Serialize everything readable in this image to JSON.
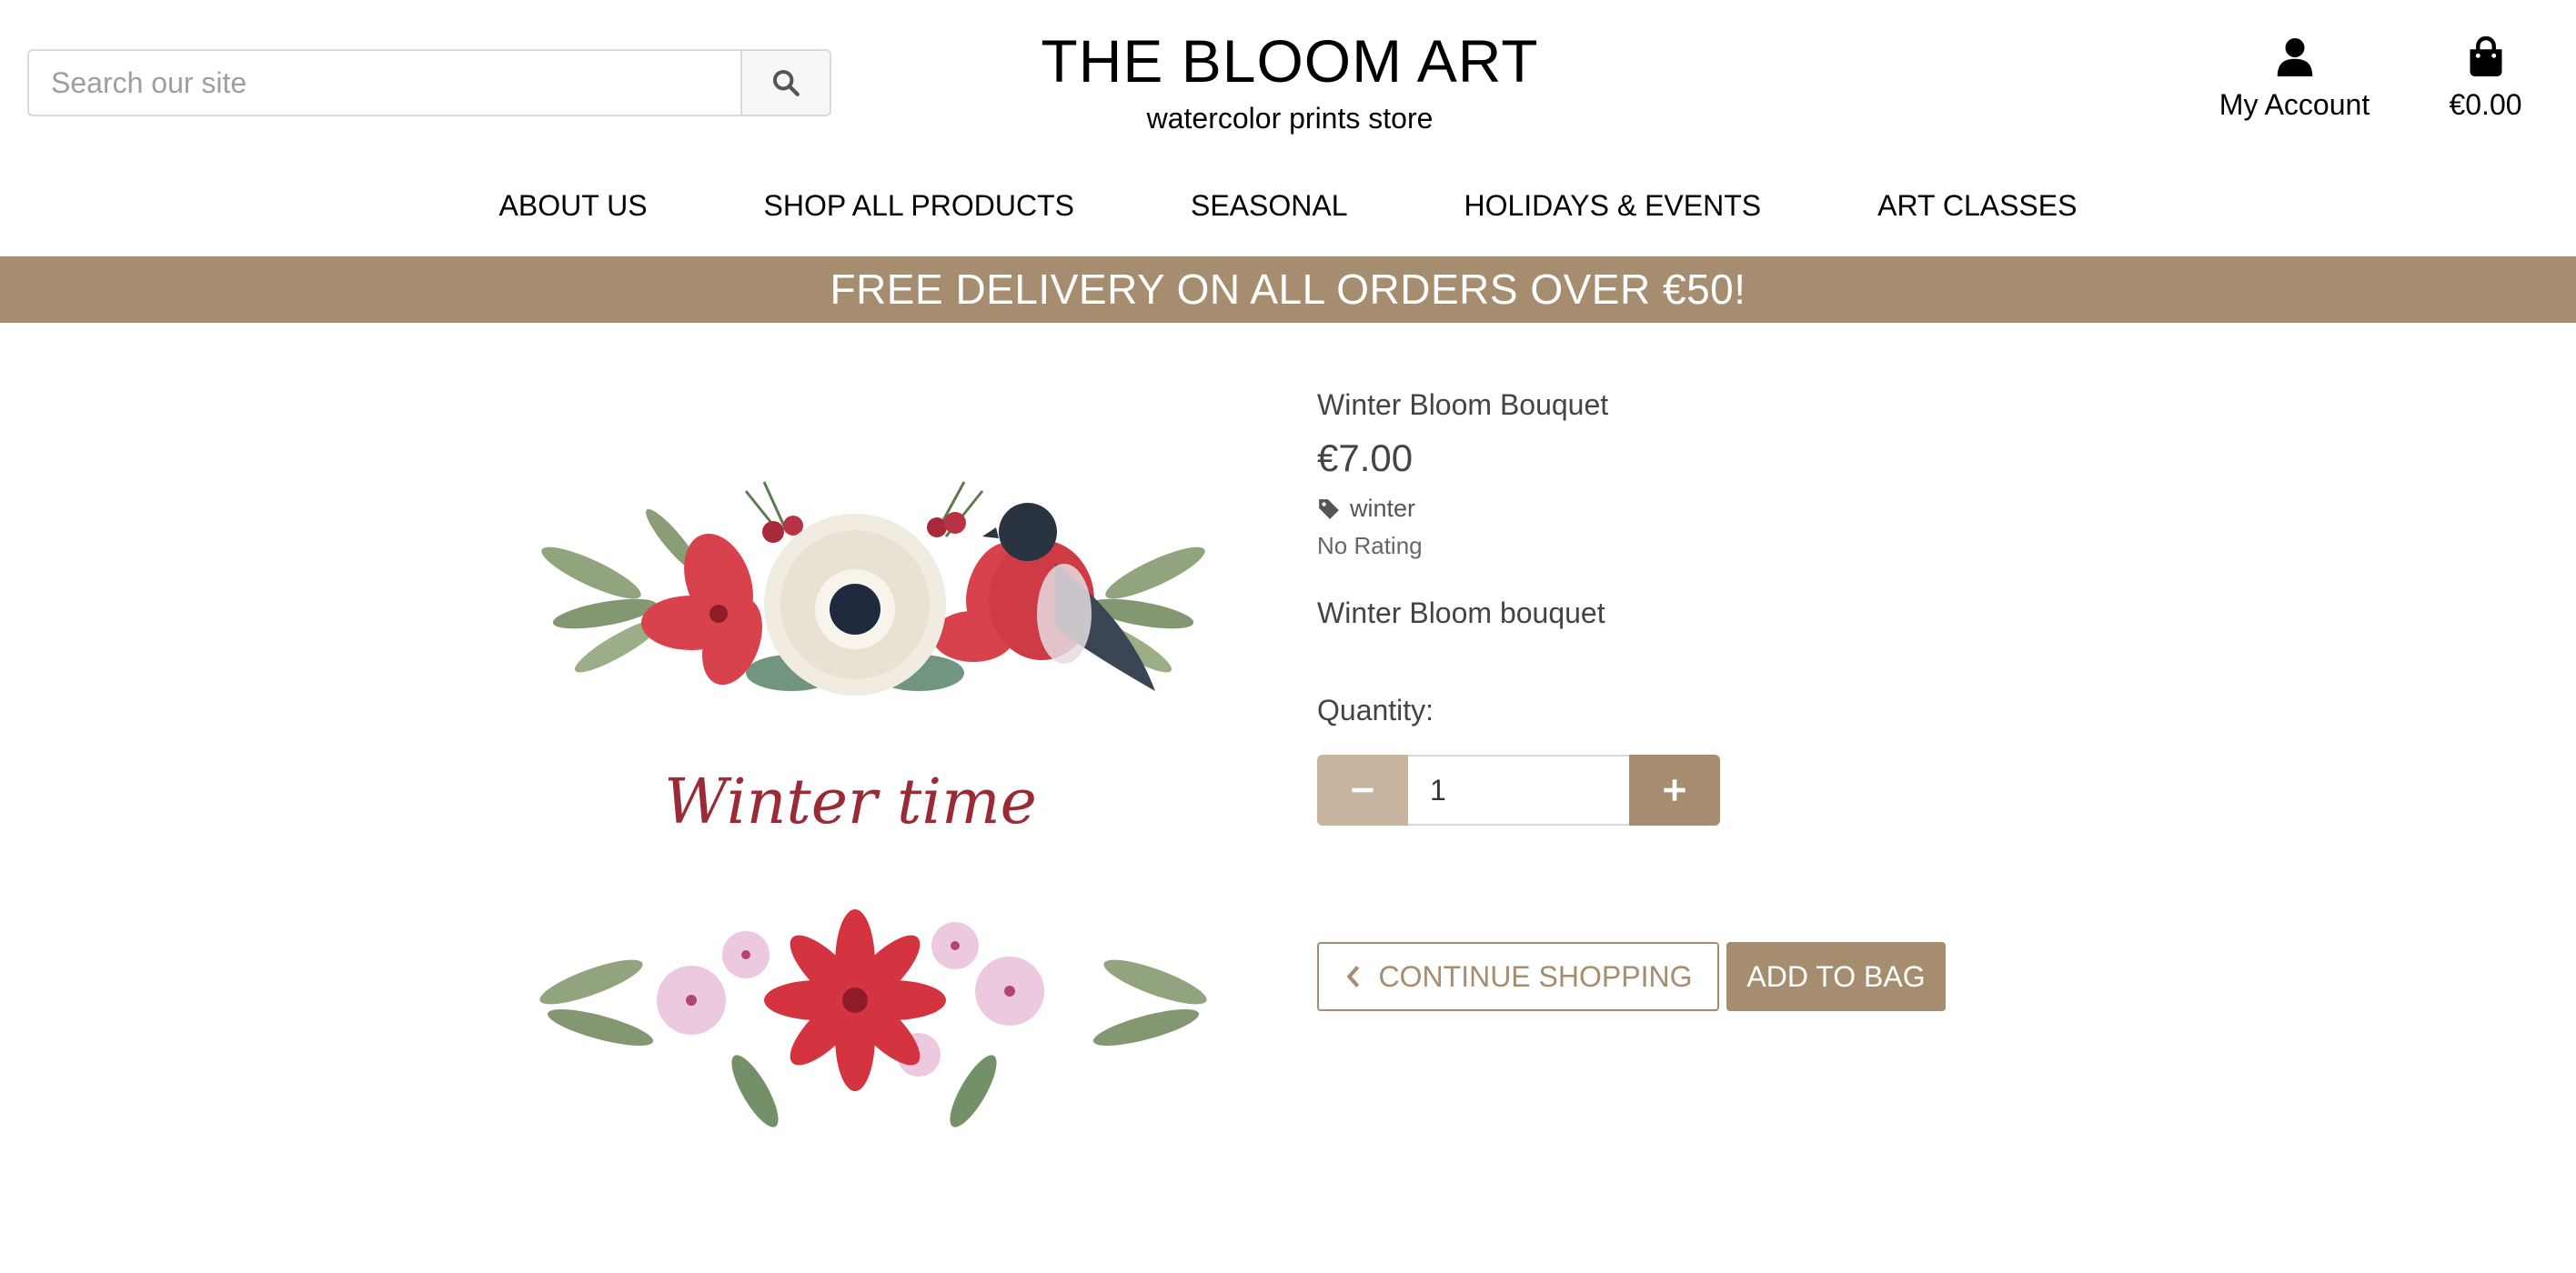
{
  "header": {
    "search": {
      "placeholder": "Search our site"
    },
    "brand": {
      "title": "THE BLOOM ART",
      "subtitle": "watercolor prints store"
    },
    "account_label": "My Account",
    "bag_total": "€0.00"
  },
  "nav": {
    "items": [
      "ABOUT US",
      "SHOP ALL PRODUCTS",
      "SEASONAL",
      "HOLIDAYS & EVENTS",
      "ART CLASSES"
    ]
  },
  "banner": {
    "text": "FREE DELIVERY ON ALL ORDERS OVER €50!"
  },
  "product": {
    "image_caption": "Winter time",
    "name": "Winter Bloom Bouquet",
    "price": "€7.00",
    "tag": "winter",
    "rating": "No Rating",
    "description": "Winter Bloom bouquet",
    "quantity_label": "Quantity:",
    "quantity": "1"
  },
  "actions": {
    "continue_label": "CONTINUE SHOPPING",
    "add_label": "ADD TO BAG"
  },
  "colors": {
    "accent": "#a68d6f",
    "accent_light": "#c7b49e",
    "text_muted": "#444444"
  }
}
